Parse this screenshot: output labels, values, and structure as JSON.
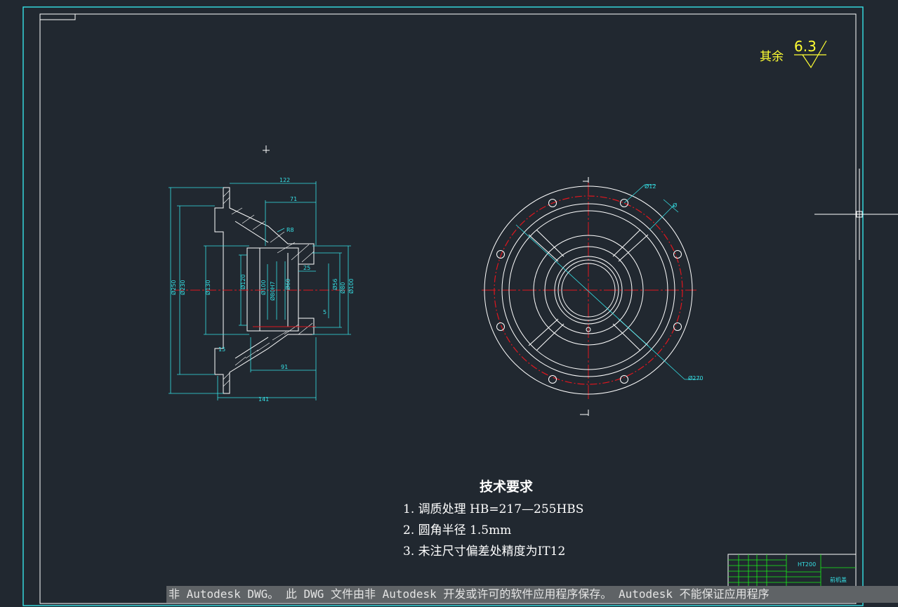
{
  "drawing": {
    "roughness": {
      "label": "其余",
      "value": "6.3"
    },
    "tech_requirements": {
      "title": "技术要求",
      "items": [
        "1. 调质处理 HB=217—255HBS",
        "2. 圆角半径  1.5mm",
        "3. 未注尺寸偏差处精度为IT12"
      ]
    },
    "section_view": {
      "dims": [
        "122",
        "71",
        "R8",
        "25",
        "141",
        "91",
        "Ø250",
        "Ø230",
        "Ø130",
        "Ø120",
        "Ø100",
        "Ø80H7",
        "Ø60",
        "Ø56",
        "Ø80",
        "Ø100",
        "15",
        "5"
      ]
    },
    "plan_view": {
      "dims": [
        "Ø12",
        "Ø",
        "Ø270"
      ]
    },
    "title_block": {
      "material": "HT200",
      "name": "前机盖"
    }
  },
  "watermark": "非 Autodesk DWG。 此 DWG 文件由非 Autodesk 开发或许可的软件应用程序保存。 Autodesk 不能保证应用程序",
  "colors": {
    "background": "#212830",
    "frame": "#ffffff",
    "cyan": "#36e1e6",
    "red": "#e0161e",
    "yellow": "#ffff33",
    "green": "#19f019"
  }
}
